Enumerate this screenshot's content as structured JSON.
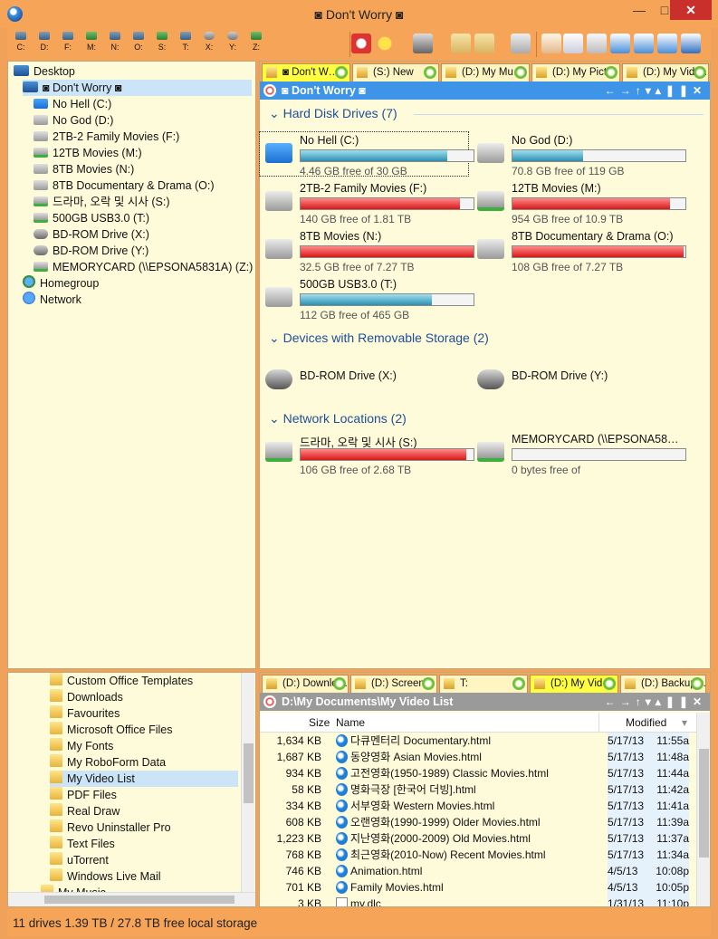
{
  "window": {
    "title": "◙ Don't Worry ◙",
    "min": "—",
    "max": "□",
    "close": "✕"
  },
  "drivebar": [
    "C:",
    "D:",
    "F:",
    "M:",
    "N:",
    "O:",
    "S:",
    "T:",
    "X:",
    "Y:",
    "Z:"
  ],
  "tree": {
    "desktop": "Desktop",
    "dont_worry": "◙ Don't Worry ◙",
    "items": [
      "No Hell (C:)",
      "No God (D:)",
      "2TB-2 Family Movies (F:)",
      "12TB Movies (M:)",
      "8TB Movies (N:)",
      "8TB Documentary & Drama (O:)",
      "드라마, 오락 및 시사 (S:)",
      "500GB USB3.0 (T:)",
      "BD-ROM Drive (X:)",
      "BD-ROM Drive (Y:)",
      "MEMORYCARD (\\\\EPSONA5831A) (Z:)"
    ],
    "homegroup": "Homegroup",
    "network": "Network"
  },
  "top_tabs": [
    "◙ Don't W…",
    "(S:) New",
    "(D:) My Mu…",
    "(D:) My Pict…",
    "(D:) My Vide…"
  ],
  "top_header": "◙ Don't Worry ◙",
  "groups": {
    "hdd": "Hard Disk Drives (7)",
    "removable": "Devices with Removable Storage (2)",
    "network": "Network Locations (2)"
  },
  "drives": [
    {
      "name": "No Hell (C:)",
      "free": "4.46 GB free of 30 GB",
      "used": 0.85,
      "red": false
    },
    {
      "name": "No God (D:)",
      "free": "70.8 GB free of 119 GB",
      "used": 0.41,
      "red": false
    },
    {
      "name": "2TB-2 Family Movies (F:)",
      "free": "140 GB free of 1.81 TB",
      "used": 0.92,
      "red": true
    },
    {
      "name": "12TB Movies (M:)",
      "free": "954 GB free of 10.9 TB",
      "used": 0.91,
      "red": true
    },
    {
      "name": "8TB Movies (N:)",
      "free": "32.5 GB free of 7.27 TB",
      "used": 1.0,
      "red": true
    },
    {
      "name": "8TB Documentary & Drama (O:)",
      "free": "108 GB free of 7.27 TB",
      "used": 0.99,
      "red": true
    },
    {
      "name": "500GB USB3.0 (T:)",
      "free": "112 GB free of 465 GB",
      "used": 0.76,
      "red": false
    }
  ],
  "removable": [
    "BD-ROM Drive (X:)",
    "BD-ROM Drive (Y:)"
  ],
  "netdrives": [
    {
      "name": "드라마, 오락 및 시사 (S:)",
      "free": "106 GB free of 2.68 TB",
      "used": 0.96,
      "red": true
    },
    {
      "name": "MEMORYCARD (\\\\EPSONA58…",
      "free": "0 bytes free of",
      "used": 0,
      "red": false
    }
  ],
  "folders": [
    "Custom Office Templates",
    "Downloads",
    "Favourites",
    "Microsoft Office Files",
    "My Fonts",
    "My RoboForm Data",
    "My Video List",
    "PDF Files",
    "Real Draw",
    "Revo Uninstaller Pro",
    "Text Files",
    "uTorrent",
    "Windows Live Mail",
    "My Music"
  ],
  "bottom_tabs": [
    "(D:) Downlo…",
    "(D:) Screen…",
    "T:",
    "(D:) My Vid…",
    "(D:) Backup…"
  ],
  "bottom_header": "D:\\My Documents\\My Video List",
  "cols": {
    "size": "Size",
    "name": "Name",
    "modified": "Modified"
  },
  "files": [
    {
      "size": "1,634 KB",
      "name": "다큐멘터리 Documentary.html",
      "date": "5/17/13",
      "time": "11:55a"
    },
    {
      "size": "1,687 KB",
      "name": "동양영화 Asian Movies.html",
      "date": "5/17/13",
      "time": "11:48a"
    },
    {
      "size": "934 KB",
      "name": "고전영화(1950-1989) Classic Movies.html",
      "date": "5/17/13",
      "time": "11:44a"
    },
    {
      "size": "58 KB",
      "name": "명화극장 [한국어 더빙].html",
      "date": "5/17/13",
      "time": "11:42a"
    },
    {
      "size": "334 KB",
      "name": "서부영화 Western Movies.html",
      "date": "5/17/13",
      "time": "11:41a"
    },
    {
      "size": "608 KB",
      "name": "오랜영화(1990-1999) Older Movies.html",
      "date": "5/17/13",
      "time": "11:39a"
    },
    {
      "size": "1,223 KB",
      "name": "지난영화(2000-2009) Old Movies.html",
      "date": "5/17/13",
      "time": "11:37a"
    },
    {
      "size": "768 KB",
      "name": "최근영화(2010-Now) Recent Movies.html",
      "date": "5/17/13",
      "time": "11:34a"
    },
    {
      "size": "746 KB",
      "name": "Animation.html",
      "date": "4/5/13",
      "time": "10:08p"
    },
    {
      "size": "701 KB",
      "name": "Family Movies.html",
      "date": "4/5/13",
      "time": "10:05p"
    },
    {
      "size": "3 KB",
      "name": "my.dlc",
      "date": "1/31/13",
      "time": "11:10p"
    }
  ],
  "status": "11 drives  1.39 TB / 27.8 TB free local storage"
}
